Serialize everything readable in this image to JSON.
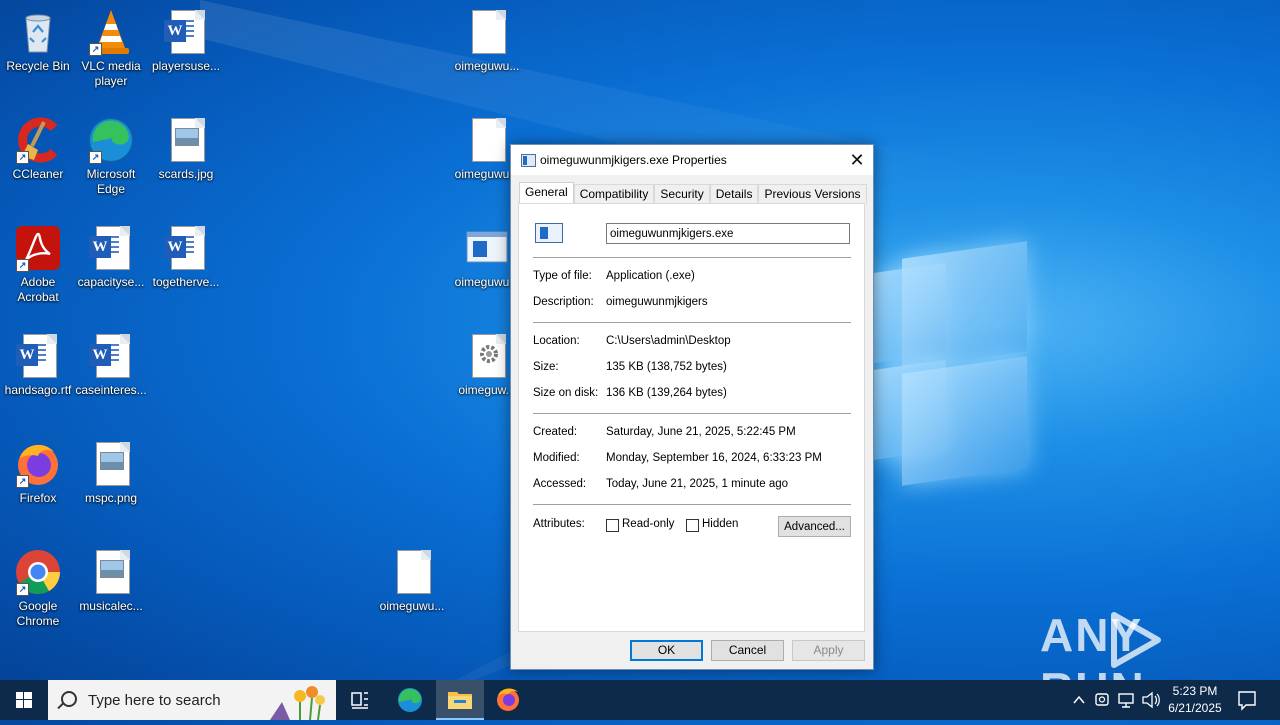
{
  "desktop": {
    "icons": [
      {
        "label": "Recycle Bin"
      },
      {
        "label": "VLC media player"
      },
      {
        "label": "playersuse..."
      },
      {
        "label": "oimeguwu..."
      },
      {
        "label": "CCleaner"
      },
      {
        "label": "Microsoft Edge"
      },
      {
        "label": "scards.jpg"
      },
      {
        "label": "oimeguwu..."
      },
      {
        "label": "Adobe Acrobat"
      },
      {
        "label": "capacityse..."
      },
      {
        "label": "togetherve..."
      },
      {
        "label": "oimeguwu..."
      },
      {
        "label": "handsago.rtf"
      },
      {
        "label": "caseinteres..."
      },
      {
        "label": "oimeguw..."
      },
      {
        "label": "Firefox"
      },
      {
        "label": "mspc.png"
      },
      {
        "label": "Google Chrome"
      },
      {
        "label": "musicalec..."
      },
      {
        "label": "oimeguwu..."
      }
    ]
  },
  "dialog": {
    "title": "oimeguwunmjkigers.exe Properties",
    "close_glyph": "✕",
    "tabs": [
      "General",
      "Compatibility",
      "Security",
      "Details",
      "Previous Versions"
    ],
    "file_name": "oimeguwunmjkigers.exe",
    "type_label": "Type of file:",
    "type_value": "Application (.exe)",
    "description_label": "Description:",
    "description_value": "oimeguwunmjkigers",
    "location_label": "Location:",
    "location_value": "C:\\Users\\admin\\Desktop",
    "size_label": "Size:",
    "size_value": "135 KB (138,752 bytes)",
    "size_on_disk_label": "Size on disk:",
    "size_on_disk_value": "136 KB (139,264 bytes)",
    "created_label": "Created:",
    "created_value": "Saturday, June 21, 2025, 5:22:45 PM",
    "modified_label": "Modified:",
    "modified_value": "Monday, September 16, 2024, 6:33:23 PM",
    "accessed_label": "Accessed:",
    "accessed_value": "Today, June 21, 2025, 1 minute ago",
    "attributes_label": "Attributes:",
    "readonly_label": "Read-only",
    "hidden_label": "Hidden",
    "advanced_label": "Advanced...",
    "ok_label": "OK",
    "cancel_label": "Cancel",
    "apply_label": "Apply"
  },
  "watermark": {
    "text": "ANY RUN"
  },
  "taskbar": {
    "search_placeholder": "Type here to search",
    "time": "5:23 PM",
    "date": "6/21/2025"
  },
  "colors": {
    "accent": "#0078d7",
    "taskbar": "#0e2a4a",
    "desktop": "#0a6fd4"
  }
}
